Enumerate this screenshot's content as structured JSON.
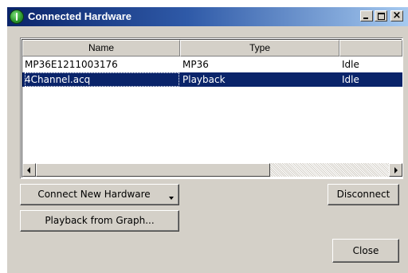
{
  "window": {
    "title": "Connected Hardware",
    "icon": "app-power-icon",
    "controls": {
      "minimize": "minimize-icon",
      "maximize": "maximize-icon",
      "close": "×"
    }
  },
  "table": {
    "columns": [
      "Name",
      "Type",
      ""
    ],
    "rows": [
      {
        "name": "MP36E1211003176",
        "type": "MP36",
        "status": "Idle",
        "selected": false
      },
      {
        "name": "4Channel.acq",
        "type": "Playback",
        "status": "Idle",
        "selected": true
      }
    ]
  },
  "buttons": {
    "connect_new": "Connect New Hardware",
    "playback_from_graph": "Playback from Graph...",
    "disconnect": "Disconnect",
    "close": "Close"
  },
  "colors": {
    "selection": "#0a246a",
    "face": "#d4d0c8",
    "titlebar_start": "#0a246a",
    "titlebar_end": "#a6caf0"
  }
}
